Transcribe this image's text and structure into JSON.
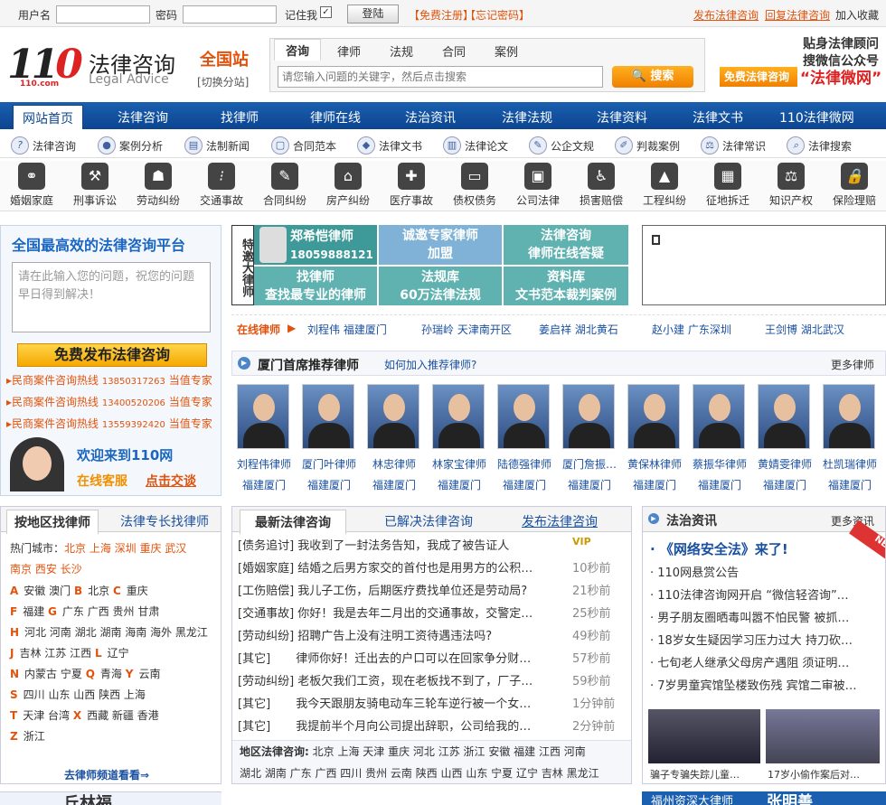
{
  "login": {
    "user_label": "用户名",
    "pwd_label": "密码",
    "remember": "记住我",
    "login_btn": "登陆",
    "register": "【免费注册】",
    "forgot": "【忘记密码】",
    "post_consult": "发布法律咨询",
    "reply_consult": "回复法律咨询",
    "favorite": "加入收藏"
  },
  "logo": {
    "cn": "法律咨询",
    "en": "Legal Advice",
    "url": "110.com"
  },
  "site": {
    "name": "全国站",
    "switch": "[切换分站]"
  },
  "search": {
    "tabs": [
      "咨询",
      "律师",
      "法规",
      "合同",
      "案例"
    ],
    "placeholder": "请您输入问题的关键字，然后点击搜索",
    "button": "搜索"
  },
  "free_consult": "免费法律咨询",
  "wechat": {
    "line1": "贴身法律顾问",
    "line2": "搜微信公众号",
    "line3": "“法律微网”"
  },
  "nav": [
    "网站首页",
    "法律咨询",
    "找律师",
    "律师在线",
    "法治资讯",
    "法律法规",
    "法律资料",
    "法律文书",
    "110法律微网"
  ],
  "subnav": [
    "法律咨询",
    "案例分析",
    "法制新闻",
    "合同范本",
    "法律文书",
    "法律论文",
    "公企文规",
    "判裁案例",
    "法律常识",
    "法律搜索"
  ],
  "categories": [
    "婚姻家庭",
    "刑事诉讼",
    "劳动纠纷",
    "交通事故",
    "合同纠纷",
    "房产纠纷",
    "医疗事故",
    "债权债务",
    "公司法律",
    "损害赔偿",
    "工程纠纷",
    "征地拆迁",
    "知识产权",
    "保险理赔"
  ],
  "left": {
    "title": "全国最高效的法律咨询平台",
    "question_placeholder": "请在此输入您的问题，祝您的问题早日得到解决！",
    "free_post": "免费发布法律咨询",
    "hotlines": [
      {
        "label": "民商案件咨询热线",
        "phone": "13850317263",
        "tag": "当值专家"
      },
      {
        "label": "民商案件咨询热线",
        "phone": "13400520206",
        "tag": "当值专家"
      },
      {
        "label": "民商案件咨询热线",
        "phone": "13559392420",
        "tag": "当值专家"
      }
    ],
    "welcome": "欢迎来到110网",
    "online_service": "在线客服",
    "trade": "点击交谈"
  },
  "featured": {
    "side": "特邀大律师",
    "cells": [
      "郑希恺律师",
      "18059888121",
      "诚邀专家律师",
      "加盟",
      "法律咨询",
      "律师在线答疑",
      "找律师",
      "查找最专业的律师",
      "法规库",
      "60万法律法规",
      "资料库",
      "文书范本裁判案例"
    ]
  },
  "online_lawyers": {
    "label": "在线律师",
    "items": [
      "刘程伟 福建厦门",
      "孙瑞岭 天津南开区",
      "姜启祥 湖北黄石",
      "赵小建 广东深圳",
      "王剑博 湖北武汉"
    ]
  },
  "recommend": {
    "title": "厦门首席推荐律师",
    "how": "如何加入推荐律师?",
    "more": "更多律师",
    "lawyers": [
      {
        "name": "刘程伟律师",
        "city": "福建厦门"
      },
      {
        "name": "厦门叶律师",
        "city": "福建厦门"
      },
      {
        "name": "林忠律师",
        "city": "福建厦门"
      },
      {
        "name": "林家宝律师",
        "city": "福建厦门"
      },
      {
        "name": "陆德强律师",
        "city": "福建厦门"
      },
      {
        "name": "厦门詹振…",
        "city": "福建厦门"
      },
      {
        "name": "黄保林律师",
        "city": "福建厦门"
      },
      {
        "name": "蔡振华律师",
        "city": "福建厦门"
      },
      {
        "name": "黄婧雯律师",
        "city": "福建厦门"
      },
      {
        "name": "杜凯瑞律师",
        "city": "福建厦门"
      }
    ]
  },
  "find": {
    "tab1": "按地区找律师",
    "tab2": "法律专长找律师",
    "hot_label": "热门城市：",
    "hot_cities": "北京 上海 深圳 重庆 武汉",
    "hot_cities2": "南京 西安 长沙",
    "groups": [
      {
        "k": "A",
        "v": "安徽 澳门"
      },
      {
        "k": "B",
        "v": "北京"
      },
      {
        "k": "C",
        "v": "重庆"
      },
      {
        "k": "F",
        "v": "福建"
      },
      {
        "k": "G",
        "v": "广东 广西 贵州 甘肃"
      },
      {
        "k": "H",
        "v": "河北 河南 湖北 湖南 海南 海外 黑龙江"
      },
      {
        "k": "J",
        "v": "吉林 江苏 江西"
      },
      {
        "k": "L",
        "v": "辽宁"
      },
      {
        "k": "N",
        "v": "内蒙古 宁夏"
      },
      {
        "k": "Q",
        "v": "青海"
      },
      {
        "k": "Y",
        "v": "云南"
      },
      {
        "k": "S",
        "v": "四川 山东 山西 陕西 上海"
      },
      {
        "k": "T",
        "v": "天津 台湾"
      },
      {
        "k": "X",
        "v": "西藏 新疆 香港"
      },
      {
        "k": "Z",
        "v": "浙江"
      }
    ],
    "channel": "去律师频道看看⇒"
  },
  "consult": {
    "tab1": "最新法律咨询",
    "tab2": "已解决法律咨询",
    "tab3": "发布法律咨询",
    "rows": [
      {
        "cat": "[债务追讨]",
        "q": "我收到了一封法务告知，我成了被告证人",
        "t": "VIP"
      },
      {
        "cat": "[婚姻家庭]",
        "q": "结婚之后男方家交的首付也是用男方的公积…",
        "t": "10秒前"
      },
      {
        "cat": "[工伤赔偿]",
        "q": "我儿子工伤，后期医疗费找单位还是劳动局?",
        "t": "21秒前"
      },
      {
        "cat": "[交通事故]",
        "q": "你好！我是去年二月出的交通事故，交警定…",
        "t": "25秒前"
      },
      {
        "cat": "[劳动纠纷]",
        "q": "招聘广告上没有注明工资待遇违法吗?",
        "t": "49秒前"
      },
      {
        "cat": "[其它]",
        "q": "律师你好！迁出去的户口可以在回家争分财…",
        "t": "57秒前"
      },
      {
        "cat": "[劳动纠纷]",
        "q": "老板欠我们工资，现在老板找不到了，厂子…",
        "t": "59秒前"
      },
      {
        "cat": "[其它]",
        "q": "我今天跟朋友骑电动车三轮车逆行被一个女…",
        "t": "1分钟前"
      },
      {
        "cat": "[其它]",
        "q": "我提前半个月向公司提出辞职，公司给我的…",
        "t": "2分钟前"
      }
    ],
    "region_label": "地区法律咨询:",
    "regions1": "北京 上海 天津 重庆 河北 江苏 浙江 安徽 福建 江西 河南",
    "regions2": "湖北 湖南 广东 广西 四川 贵州 云南 陕西 山西 山东 宁夏 辽宁 吉林 黑龙江"
  },
  "news": {
    "title": "法治资讯",
    "more": "更多资讯",
    "new_tag": "NEW",
    "items": [
      "《网络安全法》来了!",
      "110网悬赏公告",
      "110法律咨询网开启 “微信轻咨询”…",
      "男子朋友圈晒毒叫嚣不怕民警 被抓…",
      "18岁女生疑因学习压力过大 持刀砍…",
      "七旬老人继承父母房产遇阻 须证明…",
      "7岁男童宾馆坠楼致伤残 宾馆二审被…"
    ],
    "pics": [
      "骗子专骗失踪儿童…",
      "17岁小偷作案后对…"
    ]
  },
  "bottom": {
    "lawyer1": "丘林福",
    "tag1": "福州资深大律师",
    "lawyer2": "张明善"
  }
}
